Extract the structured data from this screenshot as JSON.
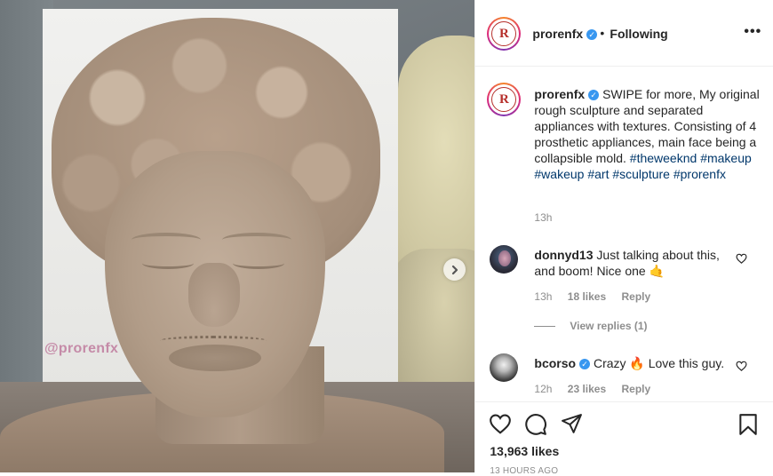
{
  "header": {
    "username": "prorenfx",
    "dot": "•",
    "follow_status": "Following",
    "more": "•••",
    "avatar_letter": "R"
  },
  "media": {
    "watermark": "@prorenfx",
    "next_icon": "chevron-right-icon"
  },
  "caption": {
    "username": "prorenfx",
    "text": "SWIPE for more, My original rough sculpture and separated appliances with textures. Consisting of 4 prosthetic appliances, main face being a collapsible mold.",
    "hashtags": [
      "#theweeknd",
      "#makeup",
      "#wakeup",
      "#art",
      "#sculpture",
      "#prorenfx"
    ],
    "time": "13h"
  },
  "comments": [
    {
      "username": "donnyd13",
      "text": "Just talking about this, and boom! Nice one 🤙",
      "time": "13h",
      "likes": "18 likes",
      "reply": "Reply",
      "view_replies": "View replies (1)"
    },
    {
      "username": "bcorso",
      "text": "Crazy 🔥 Love this guy.",
      "time": "12h",
      "likes": "23 likes",
      "reply": "Reply"
    }
  ],
  "actions": {
    "icons": [
      "heart-icon",
      "comment-icon",
      "share-icon",
      "bookmark-icon"
    ],
    "likes": "13,963 likes",
    "timestamp": "13 HOURS AGO"
  },
  "colors": {
    "link": "#00376b",
    "verified": "#3897f0",
    "muted": "#8e8e8e"
  }
}
